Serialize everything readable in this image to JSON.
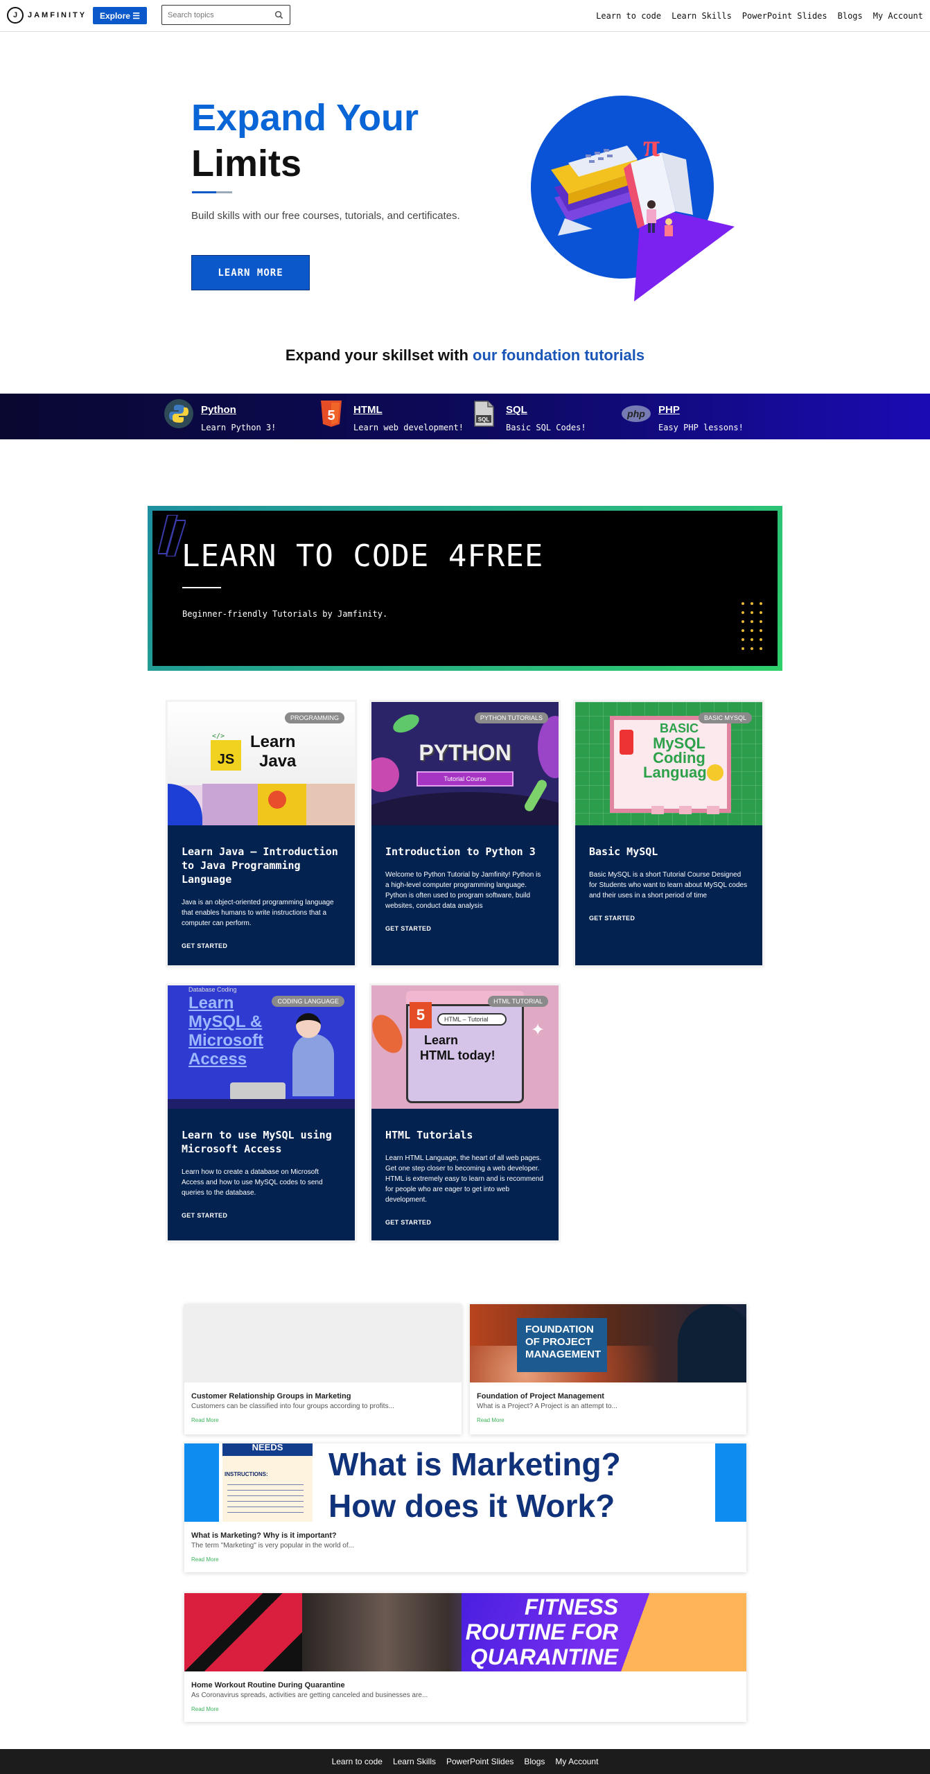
{
  "header": {
    "logo_text": "JAMFINITY",
    "explore_label": "Explore ☰",
    "search_placeholder": "Search topics",
    "nav": [
      "Learn to code",
      "Learn Skills",
      "PowerPoint Slides",
      "Blogs",
      "My Account"
    ]
  },
  "hero": {
    "title_line1": "Expand Your",
    "title_line2": "Limits",
    "subtitle": "Build skills with our free courses, tutorials, and certificates.",
    "button": "LEARN MORE",
    "colors": {
      "accent": "#0a66d6",
      "button": "#0a58ca"
    }
  },
  "foundation": {
    "text": "Expand your skillset with ",
    "highlight": "our foundation tutorials"
  },
  "tutorials": [
    {
      "name": "Python",
      "desc": "Learn Python 3!",
      "icon": "python-icon"
    },
    {
      "name": "HTML",
      "desc": "Learn web development!",
      "icon": "html5-icon"
    },
    {
      "name": "SQL",
      "desc": "Basic SQL Codes!",
      "icon": "sql-file-icon"
    },
    {
      "name": "PHP",
      "desc": "Easy PHP lessons!",
      "icon": "php-icon"
    }
  ],
  "banner": {
    "title": "LEARN TO CODE 4FREE",
    "subtitle": "Beginner-friendly Tutorials by Jamfinity."
  },
  "courses": [
    {
      "badge": "PROGRAMMING",
      "title": "Learn Java – Introduction to Java Programming Language",
      "desc": "Java is an object-oriented programming language that enables humans to write instructions that a computer can perform.",
      "cta": "GET STARTED",
      "img_text": [
        "Learn",
        "Java"
      ],
      "img_badge": "JS"
    },
    {
      "badge": "PYTHON TUTORIALS",
      "title": "Introduction to Python 3",
      "desc": "Welcome to Python Tutorial by Jamfinity! Python is a high-level computer programming language. Python is often used to program software, build websites, conduct data analysis",
      "cta": "GET STARTED",
      "img_text": [
        "PYTHON",
        "Tutorial Course"
      ]
    },
    {
      "badge": "BASIC MYSQL",
      "title": "Basic MySQL",
      "desc": "Basic MySQL is a short Tutorial Course Designed for Students who want to learn about MySQL codes and their uses in a short period of time",
      "cta": "GET STARTED",
      "img_text": [
        "BASIC",
        "MySQL",
        "Coding",
        "Language"
      ]
    },
    {
      "badge": "CODING LANGUAGE",
      "title": "Learn to use MySQL using Microsoft Access",
      "desc": "Learn how to create a database on Microsoft Access and how to use MySQL codes to send queries to the database.",
      "cta": "GET STARTED",
      "img_text": [
        "Database Coding",
        "Learn",
        "MySQL &",
        "Microsoft",
        "Access"
      ]
    },
    {
      "badge": "HTML TUTORIAL",
      "title": "HTML Tutorials",
      "desc": "Learn HTML Language, the heart of all web pages. Get one step closer to becoming a web developer. HTML is extremely easy to learn and is recommend for people who are eager to get into web development.",
      "cta": "GET STARTED",
      "img_text": [
        "HTML – Tutorial",
        "Learn",
        "HTML today!"
      ]
    }
  ],
  "blogs": [
    {
      "title": "Customer Relationship Groups in Marketing",
      "excerpt": "Customers can be classified into four groups according to profits...",
      "cta": "Read More"
    },
    {
      "title": "Foundation of Project Management",
      "excerpt": "What is a Project? A Project is an attempt to...",
      "cta": "Read More",
      "img_text": [
        "FOUNDATION",
        "OF PROJECT",
        "MANAGEMENT"
      ]
    },
    {
      "title": "What is Marketing? Why is it important?",
      "excerpt": "The term \"Marketing\" is very popular in the world of...",
      "cta": "Read More",
      "img_text": [
        "What is Marketing?",
        "How does it Work?",
        "NEEDS",
        "INSTRUCTIONS:"
      ]
    },
    {
      "title": "Home Workout Routine During Quarantine",
      "excerpt": "As Coronavirus spreads, activities are getting canceled and businesses are...",
      "cta": "Read More",
      "img_text": [
        "FITNESS",
        "ROUTINE FOR",
        "QUARANTINE"
      ]
    }
  ],
  "footer": {
    "nav": [
      "Learn to code",
      "Learn Skills",
      "PowerPoint Slides",
      "Blogs",
      "My Account"
    ]
  }
}
